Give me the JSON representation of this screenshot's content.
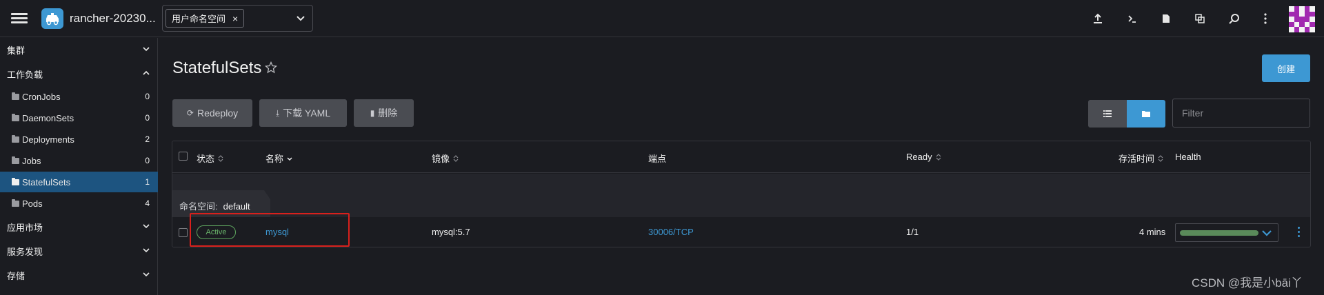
{
  "header": {
    "cluster_name": "rancher-20230...",
    "namespace_chip": "用户命名空间",
    "chip_close": "×"
  },
  "sidebar": {
    "groups": [
      {
        "label": "集群",
        "expanded": false
      },
      {
        "label": "工作负载",
        "expanded": true
      },
      {
        "label": "应用市场",
        "expanded": false
      },
      {
        "label": "服务发现",
        "expanded": false
      },
      {
        "label": "存储",
        "expanded": false
      }
    ],
    "items": [
      {
        "label": "CronJobs",
        "count": "0"
      },
      {
        "label": "DaemonSets",
        "count": "0"
      },
      {
        "label": "Deployments",
        "count": "2"
      },
      {
        "label": "Jobs",
        "count": "0"
      },
      {
        "label": "StatefulSets",
        "count": "1",
        "active": true
      },
      {
        "label": "Pods",
        "count": "4"
      }
    ]
  },
  "main": {
    "title": "StatefulSets",
    "create_label": "创建",
    "actions": {
      "redeploy": "Redeploy",
      "download_yaml": "下载 YAML",
      "delete": "删除"
    },
    "filter_placeholder": "Filter"
  },
  "table": {
    "columns": [
      "状态",
      "名称",
      "镜像",
      "端点",
      "Ready",
      "存活时间",
      "Health"
    ],
    "group": {
      "label": "命名空间:",
      "value": "default"
    },
    "rows": [
      {
        "status": "Active",
        "name": "mysql",
        "image": "mysql:5.7",
        "endpoint": "30006/TCP",
        "ready": "1/1",
        "age": "4 mins",
        "health_fraction": 1.0
      }
    ]
  },
  "colors": {
    "accent": "#3d98d3",
    "active_status": "#6ab56a",
    "annotation_box": "#d9201c"
  },
  "watermark": "CSDN @我是小bāi丫"
}
